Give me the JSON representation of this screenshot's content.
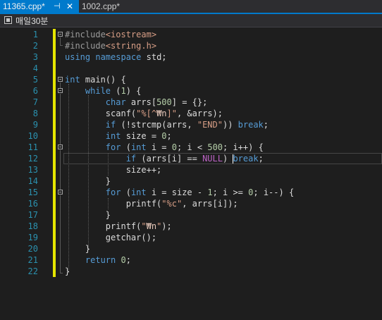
{
  "tabs": [
    {
      "label": "11365.cpp*",
      "active": true,
      "pin_icon": "pin-icon",
      "close_icon": "close-icon"
    },
    {
      "label": "1002.cpp*",
      "active": false
    }
  ],
  "navigation": {
    "project_label": "매일30분",
    "icon": "project-icon"
  },
  "editor": {
    "current_line": 12,
    "line_numbers": [
      "1",
      "2",
      "3",
      "4",
      "5",
      "6",
      "7",
      "8",
      "9",
      "10",
      "11",
      "12",
      "13",
      "14",
      "15",
      "16",
      "17",
      "18",
      "19",
      "20",
      "21",
      "22"
    ],
    "lines": [
      [
        {
          "c": "pp",
          "t": "#include"
        },
        {
          "c": "inc",
          "t": "<iostream>"
        }
      ],
      [
        {
          "c": "pp",
          "t": "#include"
        },
        {
          "c": "inc",
          "t": "<string.h>"
        }
      ],
      [
        {
          "c": "kw",
          "t": "using"
        },
        {
          "c": "txt",
          "t": " "
        },
        {
          "c": "kw",
          "t": "namespace"
        },
        {
          "c": "txt",
          "t": " std;"
        }
      ],
      [],
      [
        {
          "c": "kw",
          "t": "int"
        },
        {
          "c": "txt",
          "t": " main() {"
        }
      ],
      [
        {
          "c": "txt",
          "t": "    "
        },
        {
          "c": "kw",
          "t": "while"
        },
        {
          "c": "txt",
          "t": " ("
        },
        {
          "c": "num",
          "t": "1"
        },
        {
          "c": "txt",
          "t": ") {"
        }
      ],
      [
        {
          "c": "txt",
          "t": "        "
        },
        {
          "c": "kw",
          "t": "char"
        },
        {
          "c": "txt",
          "t": " arrs["
        },
        {
          "c": "num",
          "t": "500"
        },
        {
          "c": "txt",
          "t": "] = {};"
        }
      ],
      [
        {
          "c": "txt",
          "t": "        scanf("
        },
        {
          "c": "str",
          "t": "\"%[^"
        },
        {
          "c": "esc",
          "t": "₩n"
        },
        {
          "c": "str",
          "t": "]\""
        },
        {
          "c": "txt",
          "t": ", &arrs);"
        }
      ],
      [
        {
          "c": "txt",
          "t": "        "
        },
        {
          "c": "kw",
          "t": "if"
        },
        {
          "c": "txt",
          "t": " (!strcmp(arrs, "
        },
        {
          "c": "str",
          "t": "\"END\""
        },
        {
          "c": "txt",
          "t": ")) "
        },
        {
          "c": "kw",
          "t": "break"
        },
        {
          "c": "txt",
          "t": ";"
        }
      ],
      [
        {
          "c": "txt",
          "t": "        "
        },
        {
          "c": "kw",
          "t": "int"
        },
        {
          "c": "txt",
          "t": " size = "
        },
        {
          "c": "num",
          "t": "0"
        },
        {
          "c": "txt",
          "t": ";"
        }
      ],
      [
        {
          "c": "txt",
          "t": "        "
        },
        {
          "c": "kw",
          "t": "for"
        },
        {
          "c": "txt",
          "t": " ("
        },
        {
          "c": "kw",
          "t": "int"
        },
        {
          "c": "txt",
          "t": " i = "
        },
        {
          "c": "num",
          "t": "0"
        },
        {
          "c": "txt",
          "t": "; i < "
        },
        {
          "c": "num",
          "t": "500"
        },
        {
          "c": "txt",
          "t": "; i++) {"
        }
      ],
      [
        {
          "c": "txt",
          "t": "            "
        },
        {
          "c": "kw",
          "t": "if"
        },
        {
          "c": "txt",
          "t": " (arrs[i] == "
        },
        {
          "c": "mac",
          "t": "NULL"
        },
        {
          "c": "txt",
          "t": ") "
        },
        {
          "c": "caret",
          "t": ""
        },
        {
          "c": "kw",
          "t": "break"
        },
        {
          "c": "txt",
          "t": ";"
        }
      ],
      [
        {
          "c": "txt",
          "t": "            size++;"
        }
      ],
      [
        {
          "c": "txt",
          "t": "        }"
        }
      ],
      [
        {
          "c": "txt",
          "t": "        "
        },
        {
          "c": "kw",
          "t": "for"
        },
        {
          "c": "txt",
          "t": " ("
        },
        {
          "c": "kw",
          "t": "int"
        },
        {
          "c": "txt",
          "t": " i = size - "
        },
        {
          "c": "num",
          "t": "1"
        },
        {
          "c": "txt",
          "t": "; i >= "
        },
        {
          "c": "num",
          "t": "0"
        },
        {
          "c": "txt",
          "t": "; i--) {"
        }
      ],
      [
        {
          "c": "txt",
          "t": "            printf("
        },
        {
          "c": "str",
          "t": "\"%c\""
        },
        {
          "c": "txt",
          "t": ", arrs[i]);"
        }
      ],
      [
        {
          "c": "txt",
          "t": "        }"
        }
      ],
      [
        {
          "c": "txt",
          "t": "        printf("
        },
        {
          "c": "str",
          "t": "\""
        },
        {
          "c": "esc",
          "t": "₩n"
        },
        {
          "c": "str",
          "t": "\""
        },
        {
          "c": "txt",
          "t": ");"
        }
      ],
      [
        {
          "c": "txt",
          "t": "        getchar();"
        }
      ],
      [
        {
          "c": "txt",
          "t": "    }"
        }
      ],
      [
        {
          "c": "txt",
          "t": "    "
        },
        {
          "c": "kw",
          "t": "return"
        },
        {
          "c": "txt",
          "t": " "
        },
        {
          "c": "num",
          "t": "0"
        },
        {
          "c": "txt",
          "t": ";"
        }
      ],
      [
        {
          "c": "txt",
          "t": "}"
        }
      ]
    ]
  },
  "colors": {
    "keyword": "#569cd6",
    "string": "#d69d85",
    "number": "#b5cea8",
    "macro": "#bd63c5",
    "line_number": "#2b91af",
    "change_track": "#e5e500",
    "tab_active": "#007acc"
  }
}
